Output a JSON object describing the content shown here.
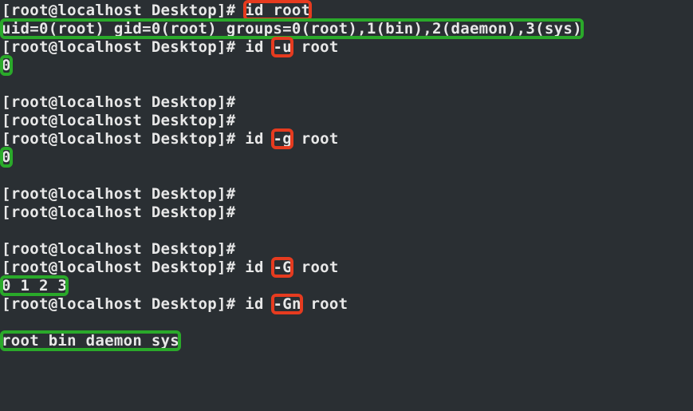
{
  "prompt": "[root@localhost Desktop]#",
  "cmd": {
    "id": "id",
    "id_root": "id root",
    "root": "root",
    "flag_u": "-u",
    "flag_g": "-g",
    "flag_G": "-G",
    "flag_Gn": "-Gn"
  },
  "out": {
    "full": "uid=0(root) gid=0(root) groups=0(root),1(bin),2(daemon),3(sys)",
    "zero": "0",
    "gids": "0 1 2 3",
    "names": "root bin daemon sys"
  }
}
